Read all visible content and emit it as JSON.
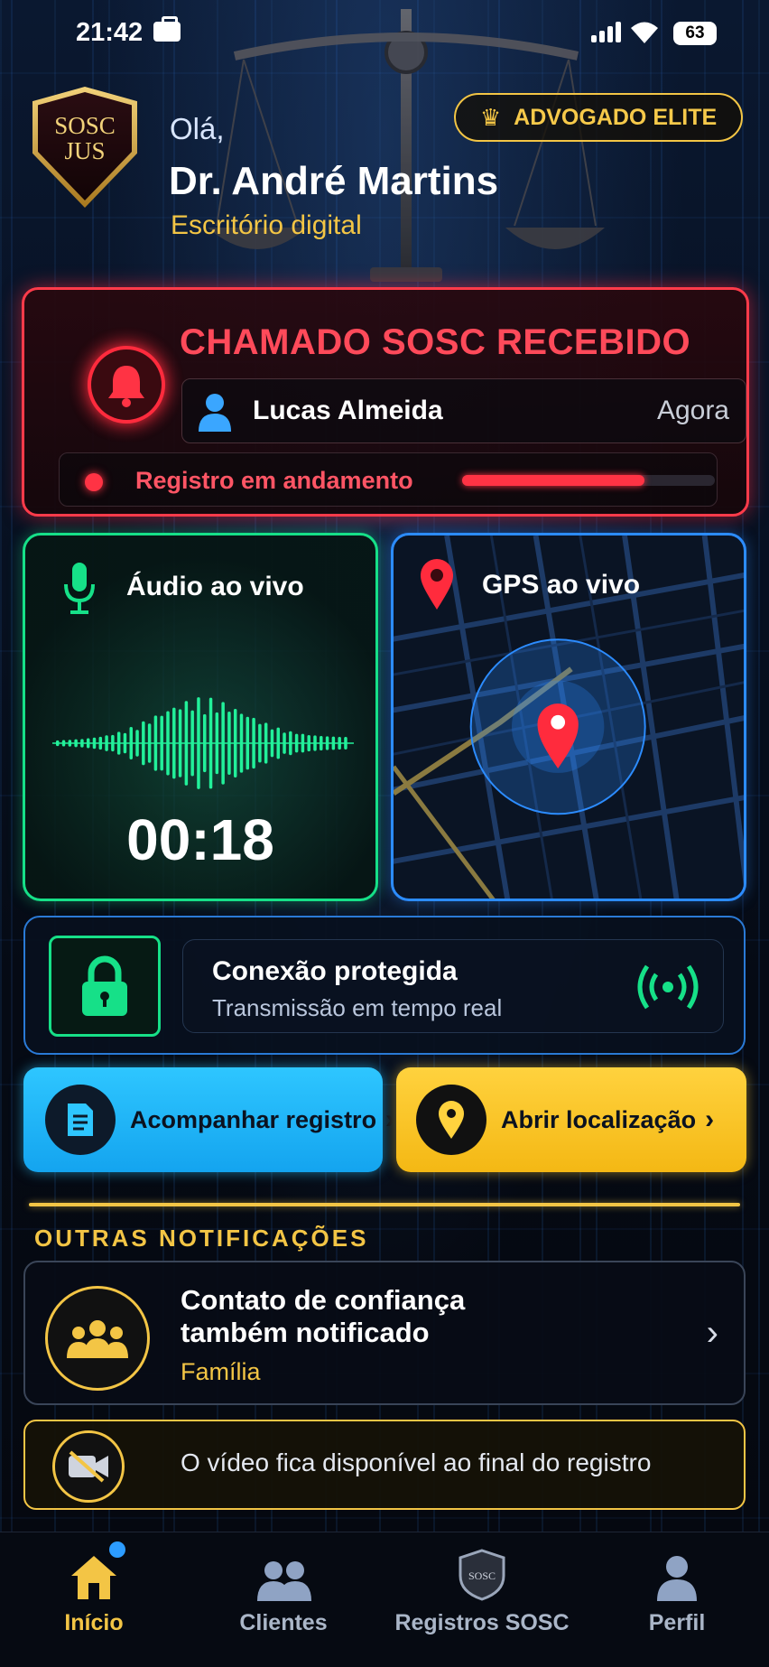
{
  "status_bar": {
    "time": "21:42",
    "battery": "63"
  },
  "header": {
    "logo_text": [
      "SOSC",
      "JUS"
    ],
    "greeting": "Olá,",
    "user_name": "Dr. André Martins",
    "subtitle": "Escritório digital",
    "badge_label": "ADVOGADO ELITE"
  },
  "alert": {
    "title": "CHAMADO SOSC RECEBIDO",
    "caller_name": "Lucas Almeida",
    "caller_time": "Agora",
    "record_status": "Registro em andamento",
    "record_progress": 0.72
  },
  "audio": {
    "title": "Áudio ao vivo",
    "timer": "00:18"
  },
  "gps": {
    "title": "GPS ao vivo"
  },
  "connection": {
    "title": "Conexão protegida",
    "subtitle": "Transmissão em tempo real"
  },
  "actions": {
    "track_label": "Acompanhar registro",
    "location_label": "Abrir localização",
    "chevron": "›"
  },
  "other": {
    "section_title": "OUTRAS NOTIFICAÇÕES",
    "trusted_title_1": "Contato de confiança",
    "trusted_title_2": "também notificado",
    "trusted_sub": "Família",
    "video_text": "O vídeo fica disponível ao final do registro"
  },
  "nav": {
    "items": [
      {
        "label": "Início",
        "icon": "home-icon"
      },
      {
        "label": "Clientes",
        "icon": "people-icon"
      },
      {
        "label": "Registros SOSC",
        "icon": "shield-icon"
      },
      {
        "label": "Perfil",
        "icon": "profile-icon"
      }
    ]
  },
  "colors": {
    "accent_gold": "#f3c545",
    "alert_red": "#ff3b4a",
    "live_green": "#16e088",
    "live_blue": "#2c8cff"
  }
}
